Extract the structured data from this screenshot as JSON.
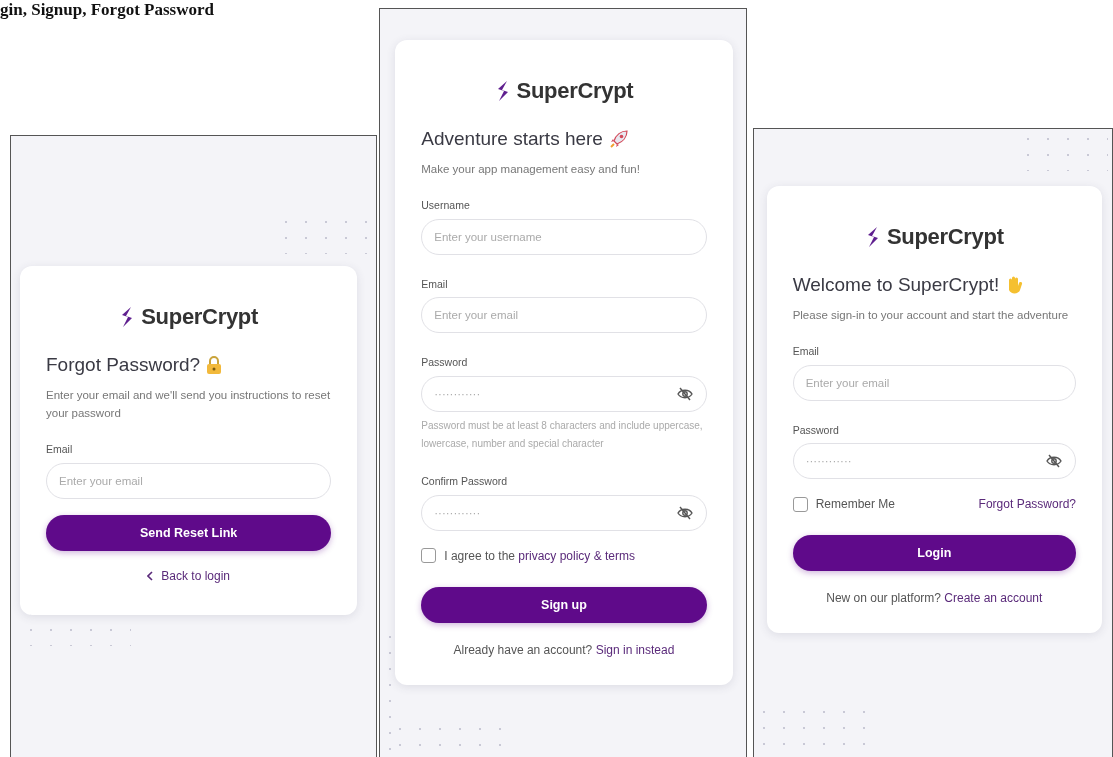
{
  "caption": "gin, Signup, Forgot Password",
  "screens": [
    {
      "kind": "forgot",
      "brand": "SuperCrypt",
      "title": "Forgot Password?",
      "subtitle": "Enter your email and we'll send you instructions to reset your password",
      "fields": [
        {
          "label": "Email",
          "placeholder": "Enter your email",
          "kind": "text"
        }
      ],
      "button": "Send Reset Link",
      "back_link": "Back to login"
    },
    {
      "kind": "signup",
      "brand": "SuperCrypt",
      "title": "Adventure starts here",
      "subtitle": "Make your app management easy and fun!",
      "fields": [
        {
          "label": "Username",
          "placeholder": "Enter your username",
          "kind": "text"
        },
        {
          "label": "Email",
          "placeholder": "Enter your email",
          "kind": "text"
        },
        {
          "label": "Password",
          "placeholder": "············",
          "kind": "password",
          "hint": "Password must be at least 8 characters and include uppercase, lowercase, number and special character"
        },
        {
          "label": "Confirm Password",
          "placeholder": "············",
          "kind": "password"
        }
      ],
      "checkbox": {
        "label": "I agree to the",
        "link": "privacy policy & terms",
        "checked": false
      },
      "button": "Sign up",
      "footer": {
        "text": "Already have an account?",
        "link": "Sign in instead"
      }
    },
    {
      "kind": "login",
      "brand": "SuperCrypt",
      "title": "Welcome to SuperCrypt!",
      "subtitle": "Please sign-in to your account and start the adventure",
      "fields": [
        {
          "label": "Email",
          "placeholder": "Enter your email",
          "kind": "text"
        },
        {
          "label": "Password",
          "placeholder": "············",
          "kind": "password"
        }
      ],
      "checkbox": {
        "label": "Remember Me",
        "checked": false
      },
      "side_link": "Forgot Password?",
      "button": "Login",
      "footer": {
        "text": "New on our platform?",
        "link": "Create an account"
      }
    }
  ]
}
